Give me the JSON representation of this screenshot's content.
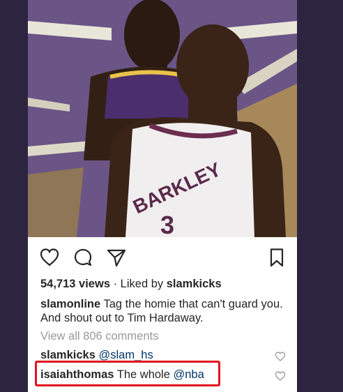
{
  "post": {
    "image_description_label": "BARKLEY",
    "views_count": "54,713 views",
    "liked_prefix": "· Liked by",
    "liked_by": "slamkicks",
    "caption_user": "slamonline",
    "caption_text": "Tag the homie that can't guard you. And shout out to Tim Hardaway.",
    "view_all_comments": "View all 806 comments",
    "comments": [
      {
        "user": "slamkicks",
        "text": "",
        "mention": "@slam_hs"
      },
      {
        "user": "isaiahthomas",
        "text": "The whole",
        "mention": "@nba"
      }
    ]
  },
  "icons": {
    "like": "heart-icon",
    "comment": "comment-bubble-icon",
    "share": "paper-plane-icon",
    "save": "bookmark-icon",
    "comment_like": "small-heart-icon"
  },
  "colors": {
    "background": "#2d2540",
    "highlight": "#e0141f",
    "mention": "#003569",
    "muted": "#999999",
    "text": "#262626"
  }
}
